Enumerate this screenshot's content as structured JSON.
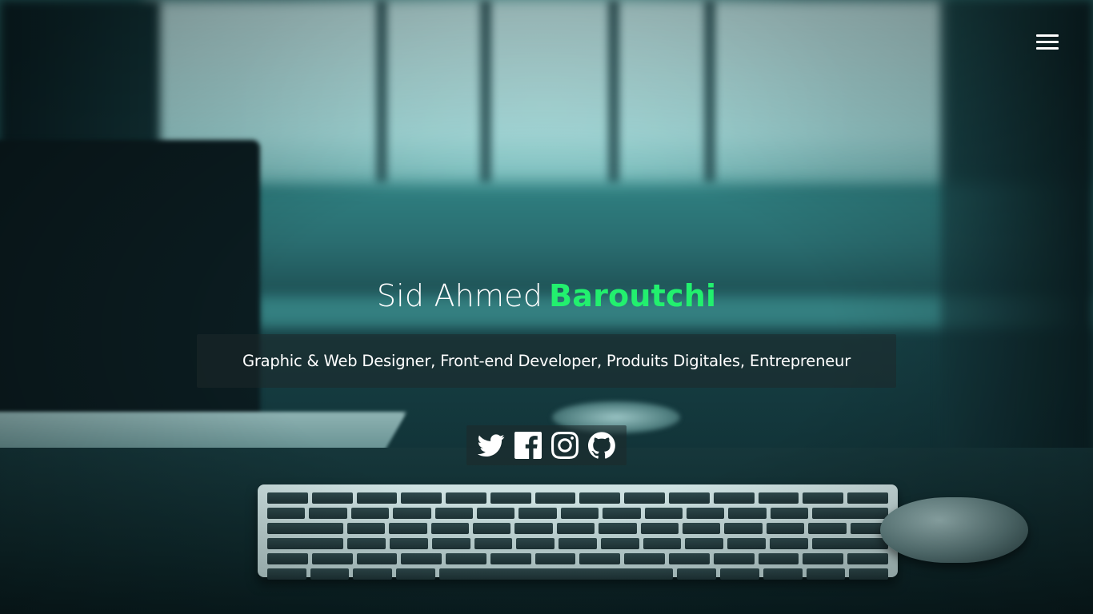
{
  "header": {
    "menu_icon": "hamburger-menu-icon"
  },
  "hero": {
    "first_name": "Sid Ahmed",
    "last_name": "Baroutchi",
    "tagline": "Graphic & Web Designer, Front-end Developer, Produits Digitales, Entrepreneur",
    "accent_color": "#22f06e",
    "background": "blurred teal photo of a desk with a laptop, wireless keyboard and mouse in front of a window"
  },
  "social": {
    "links": [
      {
        "icon": "twitter-icon"
      },
      {
        "icon": "facebook-icon"
      },
      {
        "icon": "instagram-icon"
      },
      {
        "icon": "github-icon"
      }
    ]
  }
}
